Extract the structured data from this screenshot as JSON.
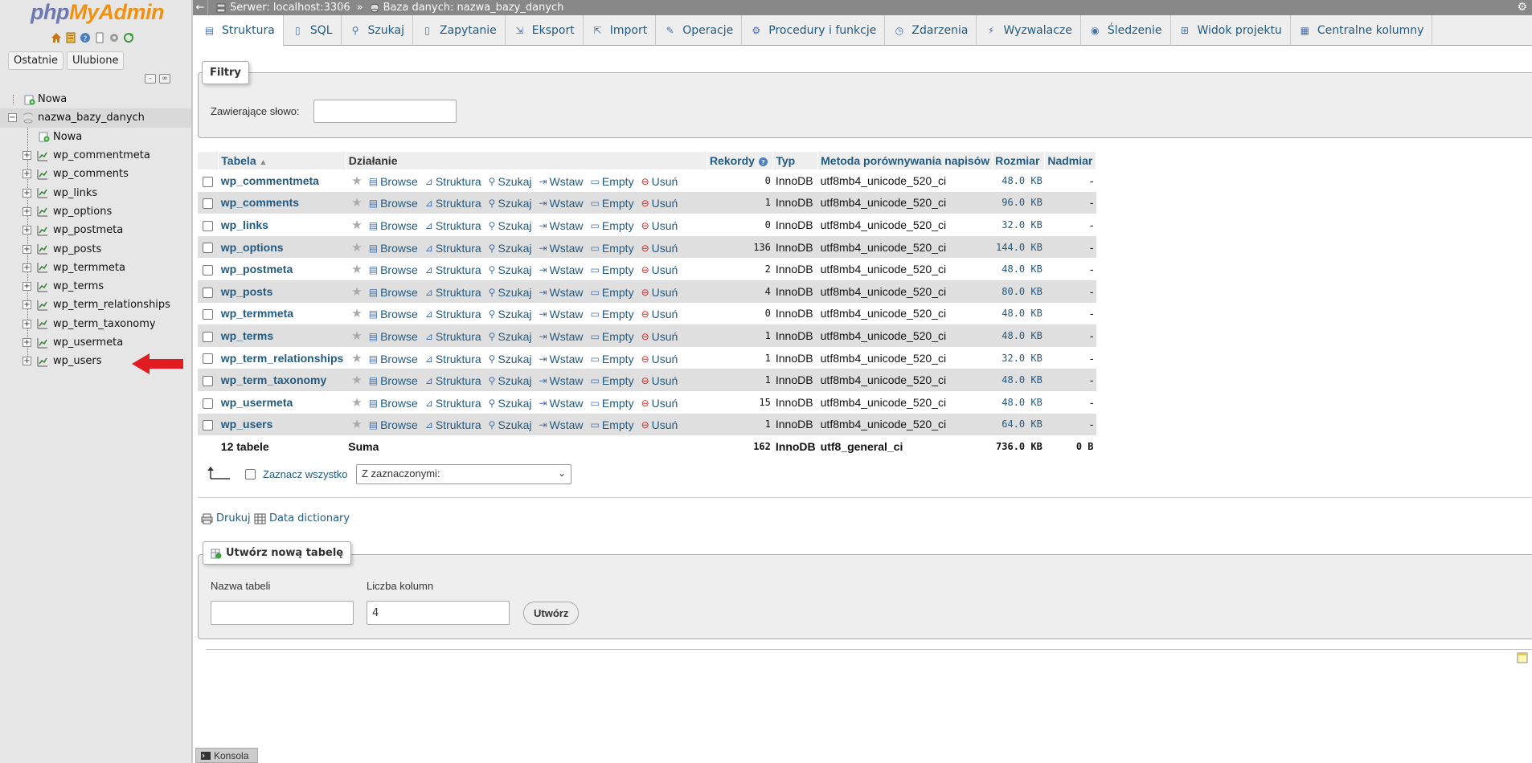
{
  "nav": {
    "logo_php": "php",
    "logo_myadmin": "MyAdmin",
    "icons": [
      "home-icon",
      "sql-icon",
      "help-icon",
      "docs-icon",
      "settings-icon",
      "reload-icon"
    ],
    "tabs": [
      "Ostatnie",
      "Ulubione"
    ],
    "tree": {
      "root_new": "Nowa",
      "database": "nazwa_bazy_danych",
      "db_new": "Nowa",
      "tables": [
        "wp_commentmeta",
        "wp_comments",
        "wp_links",
        "wp_options",
        "wp_postmeta",
        "wp_posts",
        "wp_termmeta",
        "wp_terms",
        "wp_term_relationships",
        "wp_term_taxonomy",
        "wp_usermeta",
        "wp_users"
      ]
    },
    "arrow_color": "#e21b23"
  },
  "breadcrumb": {
    "server": "Serwer: localhost:3306",
    "separator": "»",
    "database": "Baza danych: nazwa_bazy_danych"
  },
  "tabs": [
    {
      "label": "Struktura",
      "icon": "structure-icon"
    },
    {
      "label": "SQL",
      "icon": "sql-icon"
    },
    {
      "label": "Szukaj",
      "icon": "search-icon"
    },
    {
      "label": "Zapytanie",
      "icon": "query-icon"
    },
    {
      "label": "Eksport",
      "icon": "export-icon"
    },
    {
      "label": "Import",
      "icon": "import-icon"
    },
    {
      "label": "Operacje",
      "icon": "wrench-icon"
    },
    {
      "label": "Procedury i funkcje",
      "icon": "routines-icon"
    },
    {
      "label": "Zdarzenia",
      "icon": "clock-icon"
    },
    {
      "label": "Wyzwalacze",
      "icon": "triggers-icon"
    },
    {
      "label": "Śledzenie",
      "icon": "eye-icon"
    },
    {
      "label": "Widok projektu",
      "icon": "designer-icon"
    },
    {
      "label": "Centralne kolumny",
      "icon": "columns-icon"
    }
  ],
  "filters": {
    "legend": "Filtry",
    "label": "Zawierające słowo:",
    "value": ""
  },
  "table": {
    "headers": {
      "table": "Tabela",
      "action": "Działanie",
      "records": "Rekordy",
      "type": "Typ",
      "collation": "Metoda porównywania napisów",
      "size": "Rozmiar",
      "overhead": "Nadmiar"
    },
    "actions": {
      "browse": "Browse",
      "structure": "Struktura",
      "search": "Szukaj",
      "insert": "Wstaw",
      "empty": "Empty",
      "drop": "Usuń"
    },
    "rows": [
      {
        "name": "wp_commentmeta",
        "records": "0",
        "type": "InnoDB",
        "collation": "utf8mb4_unicode_520_ci",
        "size": "48.0 KB",
        "overhead": "-"
      },
      {
        "name": "wp_comments",
        "records": "1",
        "type": "InnoDB",
        "collation": "utf8mb4_unicode_520_ci",
        "size": "96.0 KB",
        "overhead": "-"
      },
      {
        "name": "wp_links",
        "records": "0",
        "type": "InnoDB",
        "collation": "utf8mb4_unicode_520_ci",
        "size": "32.0 KB",
        "overhead": "-"
      },
      {
        "name": "wp_options",
        "records": "136",
        "type": "InnoDB",
        "collation": "utf8mb4_unicode_520_ci",
        "size": "144.0 KB",
        "overhead": "-"
      },
      {
        "name": "wp_postmeta",
        "records": "2",
        "type": "InnoDB",
        "collation": "utf8mb4_unicode_520_ci",
        "size": "48.0 KB",
        "overhead": "-"
      },
      {
        "name": "wp_posts",
        "records": "4",
        "type": "InnoDB",
        "collation": "utf8mb4_unicode_520_ci",
        "size": "80.0 KB",
        "overhead": "-"
      },
      {
        "name": "wp_termmeta",
        "records": "0",
        "type": "InnoDB",
        "collation": "utf8mb4_unicode_520_ci",
        "size": "48.0 KB",
        "overhead": "-"
      },
      {
        "name": "wp_terms",
        "records": "1",
        "type": "InnoDB",
        "collation": "utf8mb4_unicode_520_ci",
        "size": "48.0 KB",
        "overhead": "-"
      },
      {
        "name": "wp_term_relationships",
        "records": "1",
        "type": "InnoDB",
        "collation": "utf8mb4_unicode_520_ci",
        "size": "32.0 KB",
        "overhead": "-"
      },
      {
        "name": "wp_term_taxonomy",
        "records": "1",
        "type": "InnoDB",
        "collation": "utf8mb4_unicode_520_ci",
        "size": "48.0 KB",
        "overhead": "-"
      },
      {
        "name": "wp_usermeta",
        "records": "15",
        "type": "InnoDB",
        "collation": "utf8mb4_unicode_520_ci",
        "size": "48.0 KB",
        "overhead": "-"
      },
      {
        "name": "wp_users",
        "records": "1",
        "type": "InnoDB",
        "collation": "utf8mb4_unicode_520_ci",
        "size": "64.0 KB",
        "overhead": "-"
      }
    ],
    "summary": {
      "count": "12 tabele",
      "label": "Suma",
      "records": "162",
      "type": "InnoDB",
      "collation": "utf8_general_ci",
      "size": "736.0 KB",
      "overhead": "0 B"
    }
  },
  "bulk": {
    "check_all": "Zaznacz wszystko",
    "with_selected": "Z zaznaczonymi:"
  },
  "links": {
    "print": "Drukuj",
    "data_dictionary": "Data dictionary"
  },
  "create": {
    "legend": "Utwórz nową tabelę",
    "name_label": "Nazwa tabeli",
    "name_value": "",
    "columns_label": "Liczba kolumn",
    "columns_value": "4",
    "submit": "Utwórz"
  },
  "console": {
    "label": "Konsola"
  }
}
